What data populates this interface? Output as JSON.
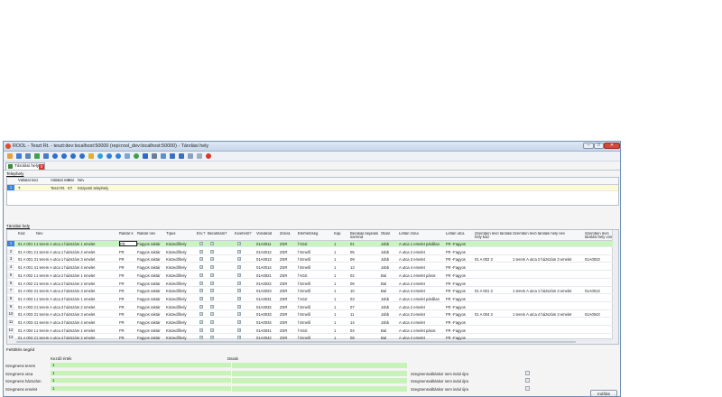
{
  "window": {
    "title": "ROOL - Teszt Rt. - teszt:dev:localhost:50000 (repi:rool_dev:localhost:50000) - Tárolási hely",
    "controls": [
      "–",
      "□",
      "✕"
    ]
  },
  "tab": {
    "label": "Tárolási hely",
    "close": "x"
  },
  "telephely": {
    "section_label": "Telephely",
    "columns": [
      "Vállalat kód",
      "Vállalat név",
      "Kód",
      "Név"
    ],
    "rows": [
      {
        "num": "1",
        "cells": [
          "T",
          "Teszt Rt.",
          "KT",
          "Központi telephely"
        ]
      }
    ]
  },
  "tarolasi_hely": {
    "section_label": "Tárolási hely",
    "columns": [
      "Kód",
      "Név",
      "Raktár k",
      "Raktár név",
      "Típus",
      "Érv.?",
      "Berakható?",
      "Kivehető?",
      "Vonalkód",
      "Zóna1",
      "Elérhetőség",
      "Kap",
      "Berakás bejárási sorrend",
      "Oldal",
      "Leltári zóna",
      "Leltári utca",
      "Szemben lévő tárolási hely kód",
      "Szemben lévő tárolási hely név",
      "Szemben lévő tárolási hely von"
    ],
    "rows": [
      {
        "num": "1",
        "cells": [
          "01 A 001 1",
          "1 terem A utca 1 házszám 1 emelet",
          "FR",
          "Fagyos raktár",
          "Kiszedőhely",
          "✓",
          "✓",
          "✓",
          "01A0011",
          "ZSR",
          "f Közi",
          "1",
          "01",
          "Jobb",
          "A utca 1 emelet párállan",
          "FR -Fagyos",
          "",
          "",
          ""
        ]
      },
      {
        "num": "2",
        "cells": [
          "01 A 001 2",
          "1 terem A utca 1 házszám 2 emelet",
          "FR",
          "Fagyos raktár",
          "Kiszedőhely",
          "✓",
          "✓",
          "✓",
          "01A0012",
          "ZSR",
          "f Emelő",
          "1",
          "05",
          "Jobb",
          "A utca 2 emelet",
          "FR -Fagyos",
          "",
          "",
          ""
        ]
      },
      {
        "num": "3",
        "cells": [
          "01 A 001 3",
          "1 terem A utca 1 házszám 3 emelet",
          "FR",
          "Fagyos raktár",
          "Kiszedőhely",
          "✓",
          "✓",
          "✓",
          "01A0013",
          "ZSR",
          "f Emelő",
          "1",
          "09",
          "Jobb",
          "A utca 3 emelet",
          "FR -Fagyos",
          "01 A 002 3",
          "1 terem A utca 2 házszám 3 emelet",
          "01A0023"
        ]
      },
      {
        "num": "4",
        "cells": [
          "01 A 001 4",
          "1 terem A utca 1 házszám 4 emelet",
          "FR",
          "Fagyos raktár",
          "Kiszedőhely",
          "✓",
          "✓",
          "✓",
          "01A0014",
          "ZSR",
          "f Emelő",
          "1",
          "13",
          "Jobb",
          "A utca 4 emelet",
          "FR -Fagyos",
          "",
          "",
          ""
        ]
      },
      {
        "num": "5",
        "cells": [
          "01 A 002 1",
          "1 terem A utca 2 házszám 1 emelet",
          "FR",
          "Fagyos raktár",
          "Kiszedőhely",
          "✓",
          "✓",
          "✓",
          "01A0021",
          "ZSR",
          "f Közi",
          "1",
          "02",
          "Bal",
          "A utca 1 emelet páros",
          "FR -Fagyos",
          "",
          "",
          ""
        ]
      },
      {
        "num": "6",
        "cells": [
          "01 A 002 2",
          "1 terem A utca 2 házszám 2 emelet",
          "FR",
          "Fagyos raktár",
          "Kiszedőhely",
          "✓",
          "✓",
          "✓",
          "01A0022",
          "ZSR",
          "f Emelő",
          "1",
          "06",
          "Bal",
          "A utca 2 emelet",
          "FR -Fagyos",
          "",
          "",
          ""
        ]
      },
      {
        "num": "7",
        "cells": [
          "01 A 002 3",
          "1 terem A utca 2 házszám 3 emelet",
          "FR",
          "Fagyos raktár",
          "Kiszedőhely",
          "✓",
          "✓",
          "✓",
          "01A0023",
          "ZSR",
          "f Emelő",
          "1",
          "10",
          "Bal",
          "A utca 3 emelet",
          "FR -Fagyos",
          "01 A 001 3",
          "1 terem A utca 1 házszám 3 emelet",
          "01A0013"
        ]
      },
      {
        "num": "8",
        "cells": [
          "01 A 003 1",
          "1 terem A utca 3 házszám 1 emelet",
          "FR",
          "Fagyos raktár",
          "Kiszedőhely",
          "✓",
          "✓",
          "✓",
          "01A0031",
          "ZSR",
          "f Közi",
          "1",
          "03",
          "Jobb",
          "A utca 1 emelet párállan",
          "FR -Fagyos",
          "",
          "",
          ""
        ]
      },
      {
        "num": "9",
        "cells": [
          "01 A 003 2",
          "1 terem A utca 3 házszám 2 emelet",
          "FR",
          "Fagyos raktár",
          "Kiszedőhely",
          "✓",
          "✓",
          "✓",
          "01A0032",
          "ZSR",
          "f Emelő",
          "1",
          "07",
          "Jobb",
          "A utca 2 emelet",
          "FR -Fagyos",
          "",
          "",
          ""
        ]
      },
      {
        "num": "10",
        "cells": [
          "01 A 003 3",
          "1 terem A utca 3 házszám 3 emelet",
          "FR",
          "Fagyos raktár",
          "Kiszedőhely",
          "✓",
          "✓",
          "✓",
          "01A0033",
          "ZSR",
          "f Emelő",
          "1",
          "11",
          "Jobb",
          "A utca 3 emelet",
          "FR -Fagyos",
          "01 A 004 3",
          "1 terem A utca 4 házszám 3 emelet",
          "01A0043"
        ]
      },
      {
        "num": "11",
        "cells": [
          "01 A 003 4",
          "1 terem A utca 3 házszám 4 emelet",
          "FR",
          "Fagyos raktár",
          "Kiszedőhely",
          "✓",
          "✓",
          "✓",
          "01A0034",
          "ZSR",
          "f Emelő",
          "1",
          "14",
          "Jobb",
          "A utca 4 emelet",
          "FR -Fagyos",
          "",
          "",
          ""
        ]
      },
      {
        "num": "12",
        "cells": [
          "01 A 004 1",
          "1 terem A utca 4 házszám 1 emelet",
          "FR",
          "Fagyos raktár",
          "Kiszedőhely",
          "✓",
          "✓",
          "✓",
          "01A0041",
          "ZSR",
          "f Közi",
          "1",
          "04",
          "Bal",
          "A utca 1 emelet páros",
          "FR -Fagyos",
          "",
          "",
          ""
        ]
      },
      {
        "num": "13",
        "cells": [
          "01 A 004 2",
          "1 terem A utca 4 házszám 2 emelet",
          "FR",
          "Fagyos raktár",
          "Kiszedőhely",
          "✓",
          "✓",
          "✓",
          "01A0042",
          "ZSR",
          "f Emelő",
          "1",
          "08",
          "Bal",
          "A utca 2 emelet",
          "FR -Fagyos",
          "",
          "",
          ""
        ]
      }
    ]
  },
  "helper": {
    "section_label": "Feltöltés segéd",
    "col_start": "Kezdő érték",
    "col_count": "Darab",
    "rows": [
      {
        "label": "Szegmens  terem",
        "value": "1",
        "note": ""
      },
      {
        "label": "Szegmens  utca",
        "value": "1",
        "note": "Szegmensváltáskor nem indul újra"
      },
      {
        "label": "Szegmens  házszám",
        "value": "1",
        "note": "Szegmensváltáskor nem indul újra"
      },
      {
        "label": "Szegmens  emelet",
        "value": "1",
        "note": "Szegmensváltáskor nem indul újra"
      }
    ],
    "button": "Indítás"
  }
}
